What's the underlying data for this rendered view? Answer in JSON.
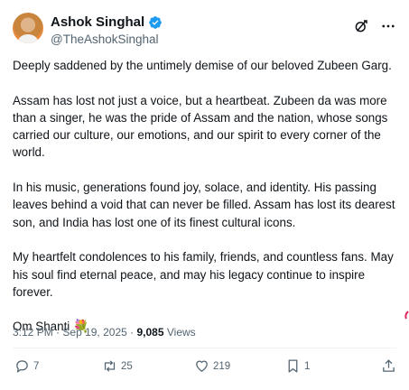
{
  "author": {
    "display_name": "Ashok Singhal",
    "handle": "@TheAshokSinghal"
  },
  "post": {
    "paragraphs": [
      "Deeply saddened by the untimely demise of our beloved Zubeen Garg.",
      "Assam has lost not just a voice, but a heartbeat. Zubeen da was more than a singer, he was the pride of Assam and the nation, whose songs carried our culture, our emotions, and our spirit to every corner of the world.",
      "In his music, generations found joy, solace, and identity. His passing leaves behind a void that can never be filled. Assam has lost its dearest son, and India has lost one of its finest cultural icons.",
      "My heartfelt condolences to his family, friends, and countless fans. May his soul find eternal peace, and may his legacy continue to inspire forever."
    ],
    "closing": "Om Shanti",
    "closing_emoji": "💐"
  },
  "meta": {
    "time": "3:12 PM",
    "separator": "·",
    "date": "Sep 19, 2025",
    "views_count": "9,085",
    "views_label": "Views"
  },
  "actions": {
    "replies": "7",
    "reposts": "25",
    "likes": "219",
    "bookmarks": "1"
  },
  "icons": {
    "verified": "verified-badge-icon",
    "grok": "grok-icon",
    "more": "more-icon",
    "reply": "reply-icon",
    "repost": "repost-icon",
    "like": "heart-icon",
    "bookmark": "bookmark-icon",
    "share": "share-icon"
  },
  "colors": {
    "verified_blue": "#1d9bf0",
    "secondary_text": "#536471",
    "primary_text": "#0f1419"
  }
}
